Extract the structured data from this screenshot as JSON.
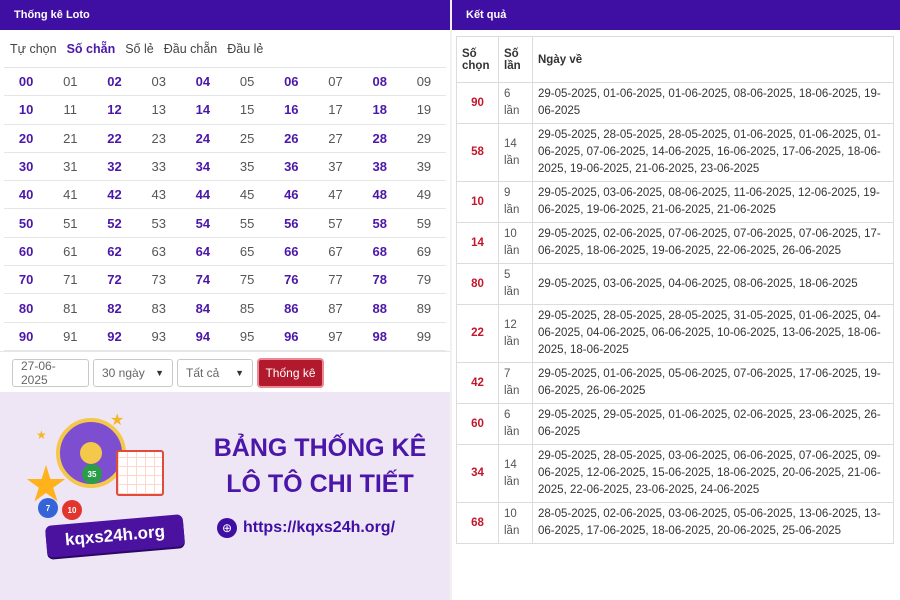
{
  "left": {
    "header": "Thống kê Loto",
    "tabs": [
      "Tự chọn",
      "Số chẵn",
      "Số lẻ",
      "Đầu chẵn",
      "Đầu lẻ"
    ],
    "active_tab": 1,
    "numbers": [
      [
        "00",
        "01",
        "02",
        "03",
        "04",
        "05",
        "06",
        "07",
        "08",
        "09"
      ],
      [
        "10",
        "11",
        "12",
        "13",
        "14",
        "15",
        "16",
        "17",
        "18",
        "19"
      ],
      [
        "20",
        "21",
        "22",
        "23",
        "24",
        "25",
        "26",
        "27",
        "28",
        "29"
      ],
      [
        "30",
        "31",
        "32",
        "33",
        "34",
        "35",
        "36",
        "37",
        "38",
        "39"
      ],
      [
        "40",
        "41",
        "42",
        "43",
        "44",
        "45",
        "46",
        "47",
        "48",
        "49"
      ],
      [
        "50",
        "51",
        "52",
        "53",
        "54",
        "55",
        "56",
        "57",
        "58",
        "59"
      ],
      [
        "60",
        "61",
        "62",
        "63",
        "64",
        "65",
        "66",
        "67",
        "68",
        "69"
      ],
      [
        "70",
        "71",
        "72",
        "73",
        "74",
        "75",
        "76",
        "77",
        "78",
        "79"
      ],
      [
        "80",
        "81",
        "82",
        "83",
        "84",
        "85",
        "86",
        "87",
        "88",
        "89"
      ],
      [
        "90",
        "91",
        "92",
        "93",
        "94",
        "95",
        "96",
        "97",
        "98",
        "99"
      ]
    ],
    "controls": {
      "date": "27-06-2025",
      "range": "30 ngày",
      "filter": "Tất cả",
      "submit": "Thống kê"
    }
  },
  "banner": {
    "title_line1": "BẢNG THỐNG KÊ",
    "title_line2": "LÔ TÔ CHI TIẾT",
    "url": "https://kqxs24h.org/",
    "logo_text": "kqxs24h.org",
    "balls": [
      "7",
      "10",
      "35"
    ]
  },
  "right": {
    "header": "Kết quả",
    "columns": [
      "Số chọn",
      "Số lần",
      "Ngày về"
    ],
    "rows": [
      {
        "num": "90",
        "count": "6 lần",
        "dates": "29-05-2025, 01-06-2025, 01-06-2025, 08-06-2025, 18-06-2025, 19-06-2025"
      },
      {
        "num": "58",
        "count": "14 lần",
        "dates": "29-05-2025, 28-05-2025, 28-05-2025, 01-06-2025, 01-06-2025, 01-06-2025, 07-06-2025, 14-06-2025, 16-06-2025, 17-06-2025, 18-06-2025, 19-06-2025, 21-06-2025, 23-06-2025"
      },
      {
        "num": "10",
        "count": "9 lần",
        "dates": "29-05-2025, 03-06-2025, 08-06-2025, 11-06-2025, 12-06-2025, 19-06-2025, 19-06-2025, 21-06-2025, 21-06-2025"
      },
      {
        "num": "14",
        "count": "10 lần",
        "dates": "29-05-2025, 02-06-2025, 07-06-2025, 07-06-2025, 07-06-2025, 17-06-2025, 18-06-2025, 19-06-2025, 22-06-2025, 26-06-2025"
      },
      {
        "num": "80",
        "count": "5 lần",
        "dates": "29-05-2025, 03-06-2025, 04-06-2025, 08-06-2025, 18-06-2025"
      },
      {
        "num": "22",
        "count": "12 lần",
        "dates": "29-05-2025, 28-05-2025, 28-05-2025, 31-05-2025, 01-06-2025, 04-06-2025, 04-06-2025, 06-06-2025, 10-06-2025, 13-06-2025, 18-06-2025, 18-06-2025"
      },
      {
        "num": "42",
        "count": "7 lần",
        "dates": "29-05-2025, 01-06-2025, 05-06-2025, 07-06-2025, 17-06-2025, 19-06-2025, 26-06-2025"
      },
      {
        "num": "60",
        "count": "6 lần",
        "dates": "29-05-2025, 29-05-2025, 01-06-2025, 02-06-2025, 23-06-2025, 26-06-2025"
      },
      {
        "num": "34",
        "count": "14 lần",
        "dates": "29-05-2025, 28-05-2025, 03-06-2025, 06-06-2025, 07-06-2025, 09-06-2025, 12-06-2025, 15-06-2025, 18-06-2025, 20-06-2025, 21-06-2025, 22-06-2025, 23-06-2025, 24-06-2025"
      },
      {
        "num": "68",
        "count": "10 lần",
        "dates": "28-05-2025, 02-06-2025, 03-06-2025, 05-06-2025, 13-06-2025, 13-06-2025, 17-06-2025, 18-06-2025, 20-06-2025, 25-06-2025"
      }
    ]
  },
  "colors": {
    "header_purple": "#3f0fa3",
    "accent_purple": "#4b17a8",
    "number_red": "#c3162a",
    "button_red": "#b3192c"
  }
}
